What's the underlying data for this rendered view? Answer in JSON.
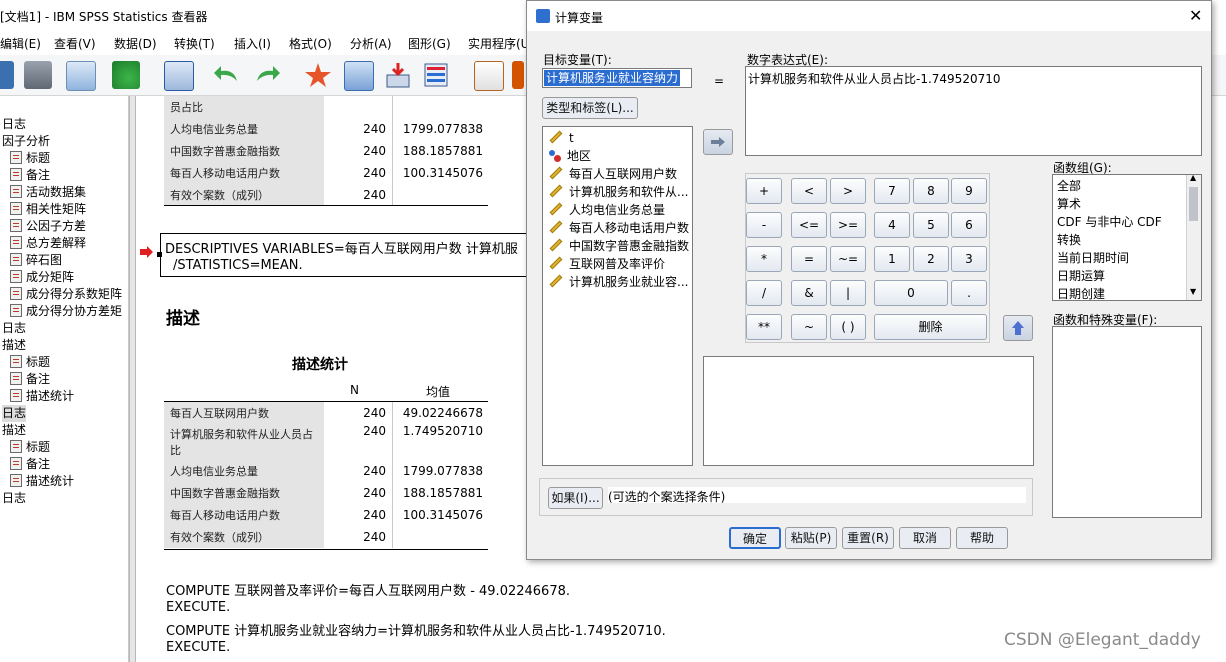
{
  "viewer": {
    "title": "[文档1] - IBM SPSS Statistics 查看器",
    "menus": [
      "编辑(E)",
      "查看(V)",
      "数据(D)",
      "转换(T)",
      "插入(I)",
      "格式(O)",
      "分析(A)",
      "图形(G)",
      "实用程序(U"
    ],
    "outline": [
      {
        "label": "日志",
        "indent": 0,
        "icon": false
      },
      {
        "label": "因子分析",
        "indent": 0,
        "icon": false
      },
      {
        "label": "标题",
        "indent": 1,
        "icon": true
      },
      {
        "label": "备注",
        "indent": 1,
        "icon": true
      },
      {
        "label": "活动数据集",
        "indent": 1,
        "icon": true
      },
      {
        "label": "相关性矩阵",
        "indent": 1,
        "icon": true
      },
      {
        "label": "公因子方差",
        "indent": 1,
        "icon": true
      },
      {
        "label": "总方差解释",
        "indent": 1,
        "icon": true
      },
      {
        "label": "碎石图",
        "indent": 1,
        "icon": true
      },
      {
        "label": "成分矩阵",
        "indent": 1,
        "icon": true
      },
      {
        "label": "成分得分系数矩阵",
        "indent": 1,
        "icon": true
      },
      {
        "label": "成分得分协方差矩",
        "indent": 1,
        "icon": true
      },
      {
        "label": "日志",
        "indent": 0,
        "icon": false
      },
      {
        "label": "描述",
        "indent": 0,
        "icon": false
      },
      {
        "label": "标题",
        "indent": 1,
        "icon": true
      },
      {
        "label": "备注",
        "indent": 1,
        "icon": true
      },
      {
        "label": "描述统计",
        "indent": 1,
        "icon": true
      },
      {
        "label": "日志",
        "indent": 0,
        "icon": false,
        "selected": true
      },
      {
        "label": "描述",
        "indent": 0,
        "icon": false
      },
      {
        "label": "标题",
        "indent": 1,
        "icon": true
      },
      {
        "label": "备注",
        "indent": 1,
        "icon": true
      },
      {
        "label": "描述统计",
        "indent": 1,
        "icon": true
      },
      {
        "label": "日志",
        "indent": 0,
        "icon": false
      }
    ],
    "top_table": [
      {
        "label": "员占比",
        "n": "",
        "mean": ""
      },
      {
        "label": "人均电信业务总量",
        "n": "240",
        "mean": "1799.077838"
      },
      {
        "label": "中国数字普惠金融指数",
        "n": "240",
        "mean": "188.1857881"
      },
      {
        "label": "每百人移动电话用户数",
        "n": "240",
        "mean": "100.3145076"
      },
      {
        "label": "有效个案数（成列）",
        "n": "240",
        "mean": ""
      }
    ],
    "syntax_line1": "DESCRIPTIVES VARIABLES=每百人互联网用户数 计算机服",
    "syntax_line2": "/STATISTICS=MEAN.",
    "section_title": "描述",
    "table_title": "描述统计",
    "col_n": "N",
    "col_mean": "均值",
    "table_rows": [
      {
        "label": "每百人互联网用户数",
        "n": "240",
        "mean": "49.02246678"
      },
      {
        "label": "计算机服务和软件从业人员占比",
        "n": "240",
        "mean": "1.749520710"
      },
      {
        "label": "人均电信业务总量",
        "n": "240",
        "mean": "1799.077838"
      },
      {
        "label": "中国数字普惠金融指数",
        "n": "240",
        "mean": "188.1857881"
      },
      {
        "label": "每百人移动电话用户数",
        "n": "240",
        "mean": "100.3145076"
      },
      {
        "label": "有效个案数（成列）",
        "n": "240",
        "mean": ""
      }
    ],
    "compute_lines": [
      "COMPUTE 互联网普及率评价=每百人互联网用户数 - 49.02246678.",
      "EXECUTE.",
      "COMPUTE 计算机服务业就业容纳力=计算机服务和软件从业人员占比-1.749520710.",
      "EXECUTE."
    ],
    "watermark": "CSDN @Elegant_daddy"
  },
  "dialog": {
    "title": "计算变量",
    "close_glyph": "✕",
    "target_label": "目标变量(T):",
    "target_value": "计算机服务业就业容纳力",
    "equals": "=",
    "expr_label": "数字表达式(E):",
    "expr_value": "计算机服务和软件从业人员占比-1.749520710",
    "type_label_button": "类型和标签(L)...",
    "variables": [
      {
        "label": "t",
        "kind": "scale"
      },
      {
        "label": "地区",
        "kind": "nominal"
      },
      {
        "label": "每百人互联网用户数",
        "kind": "scale"
      },
      {
        "label": "计算机服务和软件从...",
        "kind": "scale"
      },
      {
        "label": "人均电信业务总量",
        "kind": "scale"
      },
      {
        "label": "每百人移动电话用户数",
        "kind": "scale"
      },
      {
        "label": "中国数字普惠金融指数",
        "kind": "scale"
      },
      {
        "label": "互联网普及率评价",
        "kind": "scale"
      },
      {
        "label": "计算机服务业就业容...",
        "kind": "scale"
      }
    ],
    "keypad": {
      "r1": [
        "+",
        "<",
        ">",
        "7",
        "8",
        "9"
      ],
      "r2": [
        "-",
        "<=",
        ">=",
        "4",
        "5",
        "6"
      ],
      "r3": [
        "*",
        "=",
        "~=",
        "1",
        "2",
        "3"
      ],
      "r4": [
        "/",
        "&",
        "|",
        "0",
        "."
      ],
      "r5": [
        "**",
        "~",
        "( )",
        "删除"
      ]
    },
    "func_group_label": "函数组(G):",
    "func_groups": [
      "全部",
      "算术",
      "CDF 与非中心 CDF",
      "转换",
      "当前日期时间",
      "日期运算",
      "日期创建"
    ],
    "func_special_label": "函数和特殊变量(F):",
    "if_button": "如果(I)...",
    "if_text": "(可选的个案选择条件)",
    "buttons": {
      "ok": "确定",
      "paste": "粘贴(P)",
      "reset": "重置(R)",
      "cancel": "取消",
      "help": "帮助"
    }
  }
}
